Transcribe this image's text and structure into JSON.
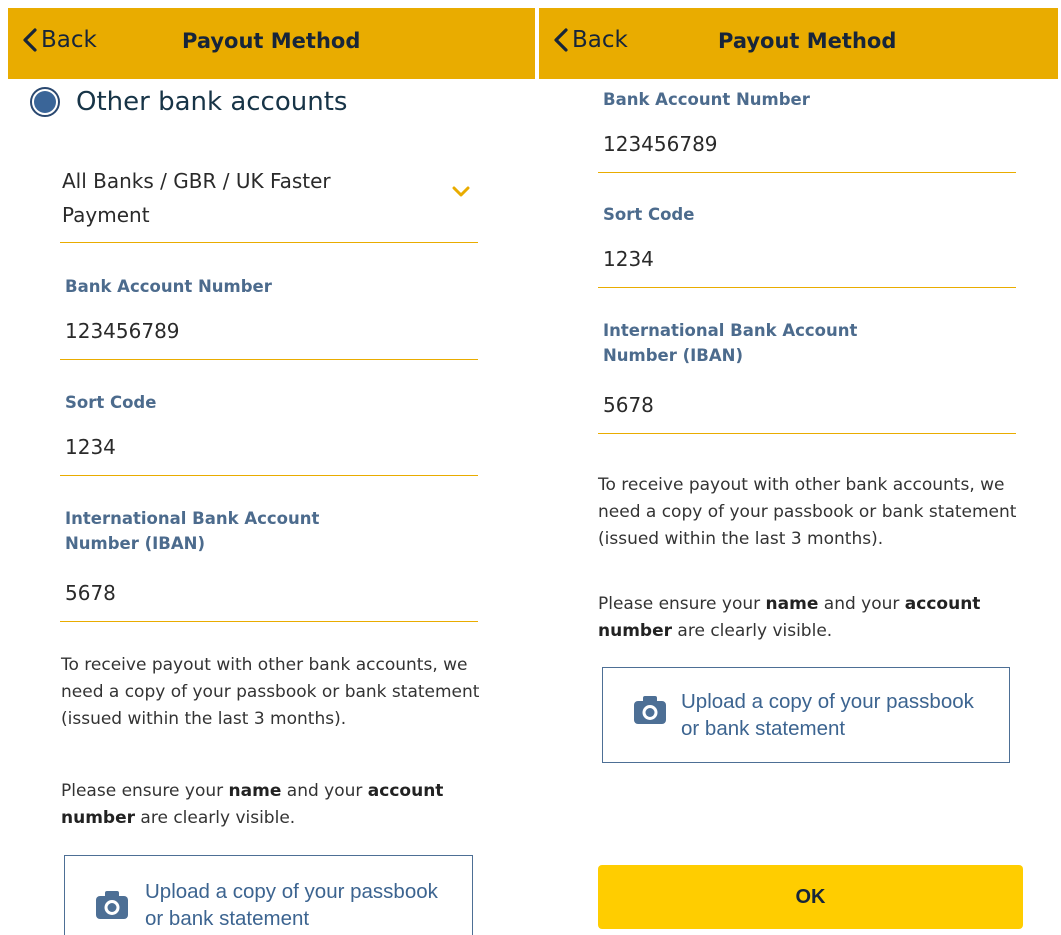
{
  "colors": {
    "header": "#e9ac00",
    "accent": "#e9ac00",
    "label": "#4c6b8d",
    "ok_button": "#ffcd00",
    "upload_border": "#4d6f95"
  },
  "left": {
    "header": {
      "back_label": "Back",
      "title": "Payout Method"
    },
    "option_label": "Other bank accounts",
    "dropdown_value": "All Banks / GBR / UK Faster Payment",
    "fields": [
      {
        "label": "Bank Account Number",
        "value": "123456789"
      },
      {
        "label": "Sort Code",
        "value": "1234"
      },
      {
        "label": "International Bank Account Number (IBAN)",
        "value": "5678"
      }
    ],
    "info": "To receive payout with other bank accounts, we need a copy of your passbook or bank statement (issued within the last 3 months).",
    "ensure": {
      "pre": "Please ensure your ",
      "bold1": "name",
      "mid": " and your ",
      "bold2": "account number",
      "post": " are clearly visible."
    },
    "upload_label": "Upload a copy of your passbook or bank statement"
  },
  "right": {
    "header": {
      "back_label": "Back",
      "title": "Payout Method"
    },
    "fields": [
      {
        "label": "Bank Account Number",
        "value": "123456789"
      },
      {
        "label": "Sort Code",
        "value": "1234"
      },
      {
        "label": "International Bank Account Number (IBAN)",
        "value": "5678"
      }
    ],
    "info": "To receive payout with other bank accounts, we need a copy of your passbook or bank statement (issued within the last 3 months).",
    "ensure": {
      "pre": "Please ensure your ",
      "bold1": "name",
      "mid": " and your ",
      "bold2": "account number",
      "post": " are clearly visible."
    },
    "upload_label": "Upload a copy of your passbook or bank statement",
    "ok_label": "OK"
  }
}
